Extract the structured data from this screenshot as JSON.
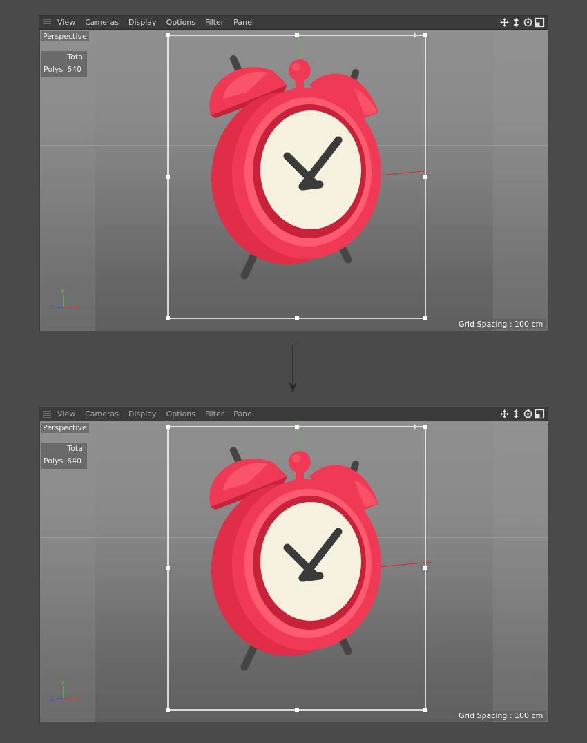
{
  "viewports": [
    {
      "menu": [
        "View",
        "Cameras",
        "Display",
        "Options",
        "Filter",
        "Panel"
      ],
      "camera_label": "Perspective",
      "stats": {
        "header": "Total",
        "label": "Polys",
        "value": "640"
      },
      "grid_spacing": "Grid Spacing : 100 cm",
      "axis_labels": {
        "y": "Y",
        "z": "Z",
        "x": "X"
      },
      "nav_icons": [
        "move-view-icon",
        "zoom-view-icon",
        "rotate-view-icon",
        "toggle-view-icon"
      ]
    },
    {
      "menu": [
        "View",
        "Cameras",
        "Display",
        "Options",
        "Filter",
        "Panel"
      ],
      "camera_label": "Perspective",
      "stats": {
        "header": "Total",
        "label": "Polys",
        "value": "640"
      },
      "grid_spacing": "Grid Spacing : 100 cm",
      "axis_labels": {
        "y": "Y",
        "z": "Z",
        "x": "X"
      },
      "nav_icons": [
        "move-view-icon",
        "zoom-view-icon",
        "rotate-view-icon",
        "toggle-view-icon"
      ]
    }
  ],
  "colors": {
    "clock_red": "#f03a55",
    "clock_red_light": "#fd5b6f",
    "clock_red_dark": "#c8223b",
    "dial": "#f6f1df",
    "hands": "#3b3b3b",
    "legs": "#444444",
    "axis_x": "#d33b3b",
    "axis_y": "#5fbf48",
    "axis_z": "#3c55d6"
  },
  "flow_arrow_icon": "arrow-down-icon"
}
